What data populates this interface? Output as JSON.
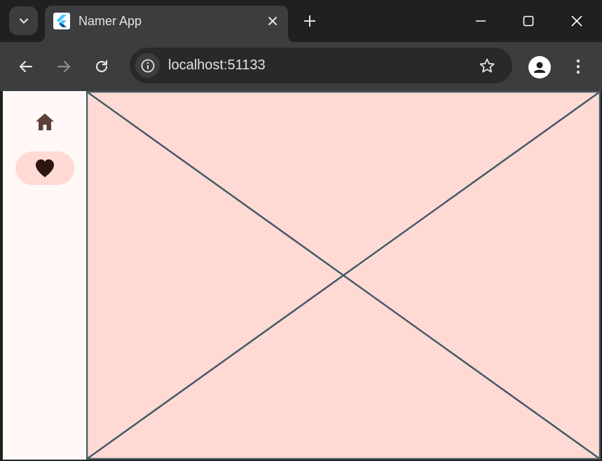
{
  "browser": {
    "tab": {
      "title": "Namer App",
      "favicon": "flutter-logo-icon",
      "close_icon": "close-icon"
    },
    "tab_search_icon": "chevron-down-icon",
    "new_tab_icon": "plus-icon",
    "window_controls": [
      "minimize-icon",
      "maximize-icon",
      "close-icon"
    ],
    "toolbar": {
      "back_icon": "arrow-left-icon",
      "forward_icon": "arrow-right-icon",
      "reload_icon": "reload-icon",
      "site_info_icon": "info-icon",
      "url": "localhost:51133",
      "bookmark_icon": "star-icon",
      "profile_icon": "person-icon",
      "menu_icon": "more-vertical-icon"
    }
  },
  "app": {
    "navigation_rail": [
      {
        "icon": "home-icon",
        "selected": false
      },
      {
        "icon": "favorite-icon",
        "selected": true
      }
    ],
    "main_content": "placeholder"
  },
  "colors": {
    "chrome_dark": "#1f2021",
    "chrome_toolbar": "#3c3d3e",
    "app_background": "#fff8f7",
    "accent_container": "#ffdad5",
    "placeholder_stroke": "#455a64",
    "rail_icon": "#5d4037"
  }
}
